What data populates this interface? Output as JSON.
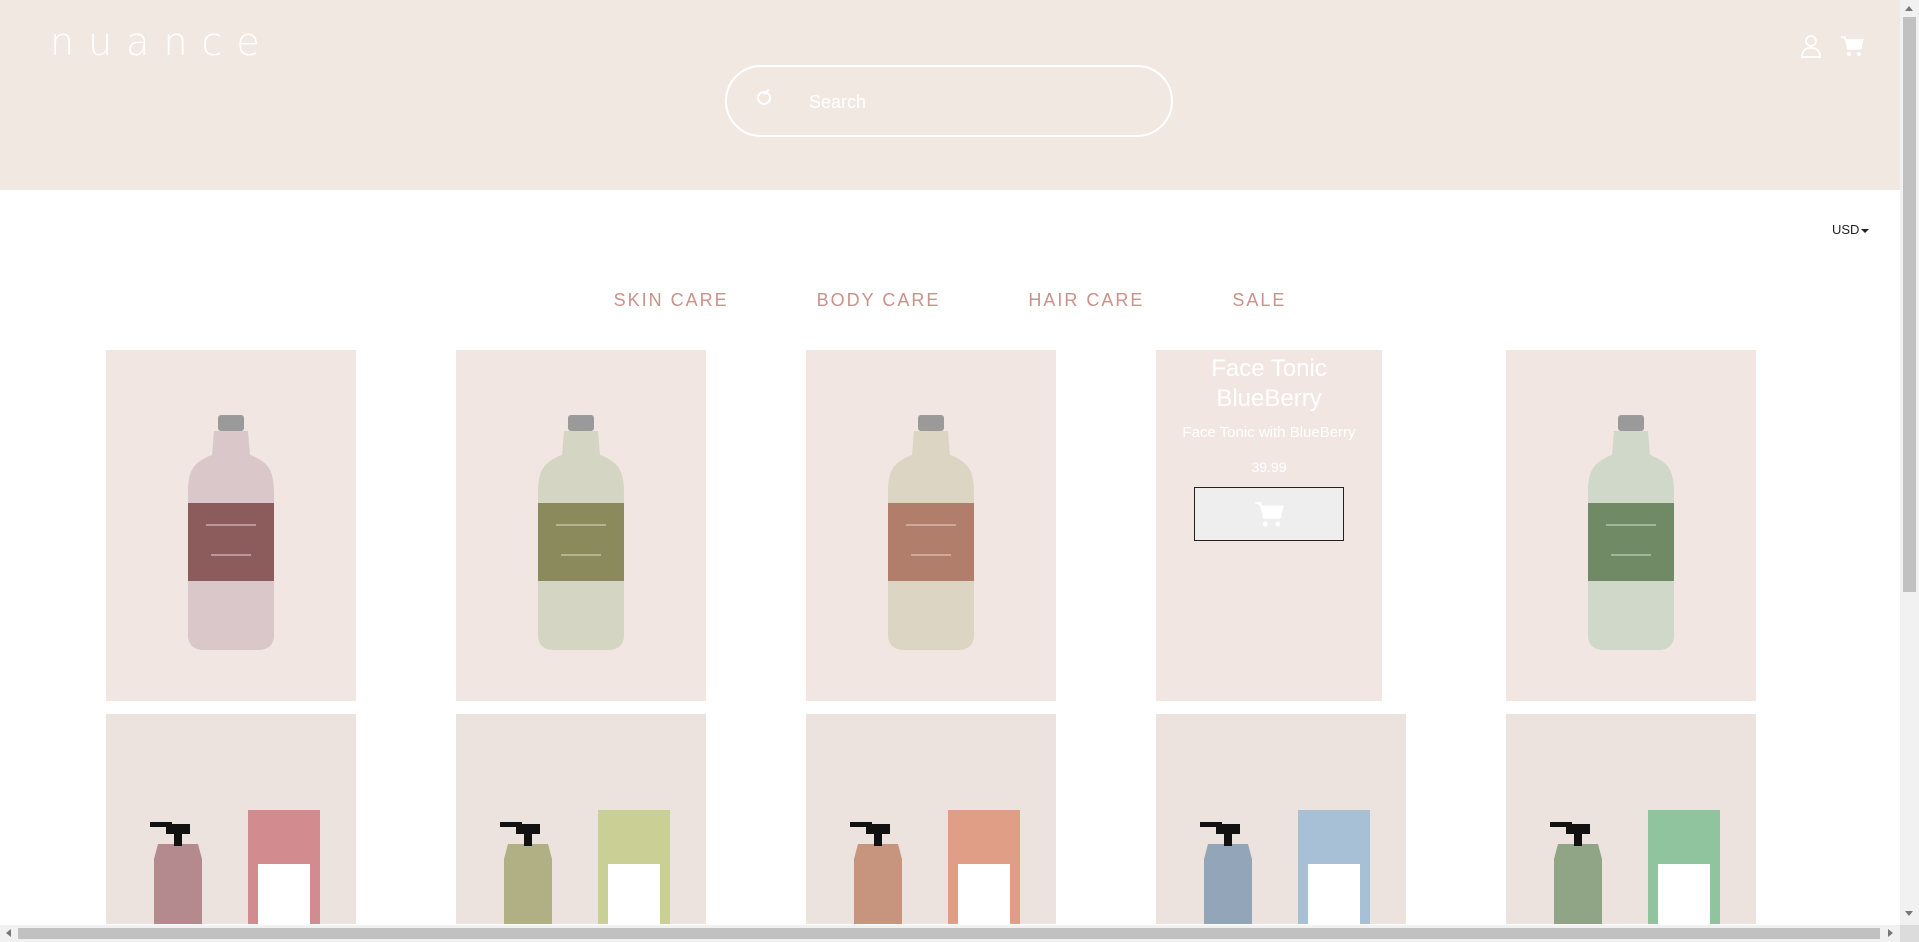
{
  "header": {
    "logo": "nuance",
    "search_placeholder": "Search",
    "icons": [
      "search-icon",
      "user-icon",
      "cart-icon"
    ]
  },
  "currency": {
    "label": "USD"
  },
  "nav": {
    "items": [
      {
        "label": "SKIN CARE"
      },
      {
        "label": "BODY CARE"
      },
      {
        "label": "HAIR CARE"
      },
      {
        "label": "SALE"
      }
    ]
  },
  "products": {
    "row1": [
      {
        "bottle_color": "#d7c3c6",
        "label_color": "#8c5c5c"
      },
      {
        "bottle_color": "#d2d3c0",
        "label_color": "#8b8a5d"
      },
      {
        "bottle_color": "#d9d3c0",
        "label_color": "#b27e6c"
      },
      {
        "hovered": true,
        "title": "Face Tonic BlueBerry",
        "description": "Face Tonic with BlueBerry",
        "price": "39.99"
      },
      {
        "bottle_color": "#cbd6c6",
        "label_color": "#6f8a64"
      }
    ],
    "row2": [
      {
        "pump_color": "#b58a8e",
        "box_color": "#d28b8f"
      },
      {
        "pump_color": "#b1b084",
        "box_color": "#c9cf95"
      },
      {
        "pump_color": "#c7957e",
        "box_color": "#e09e86"
      },
      {
        "pump_color": "#93a6b9",
        "box_color": "#a7c0d6"
      },
      {
        "pump_color": "#8fa586",
        "box_color": "#8fc49f"
      }
    ]
  }
}
